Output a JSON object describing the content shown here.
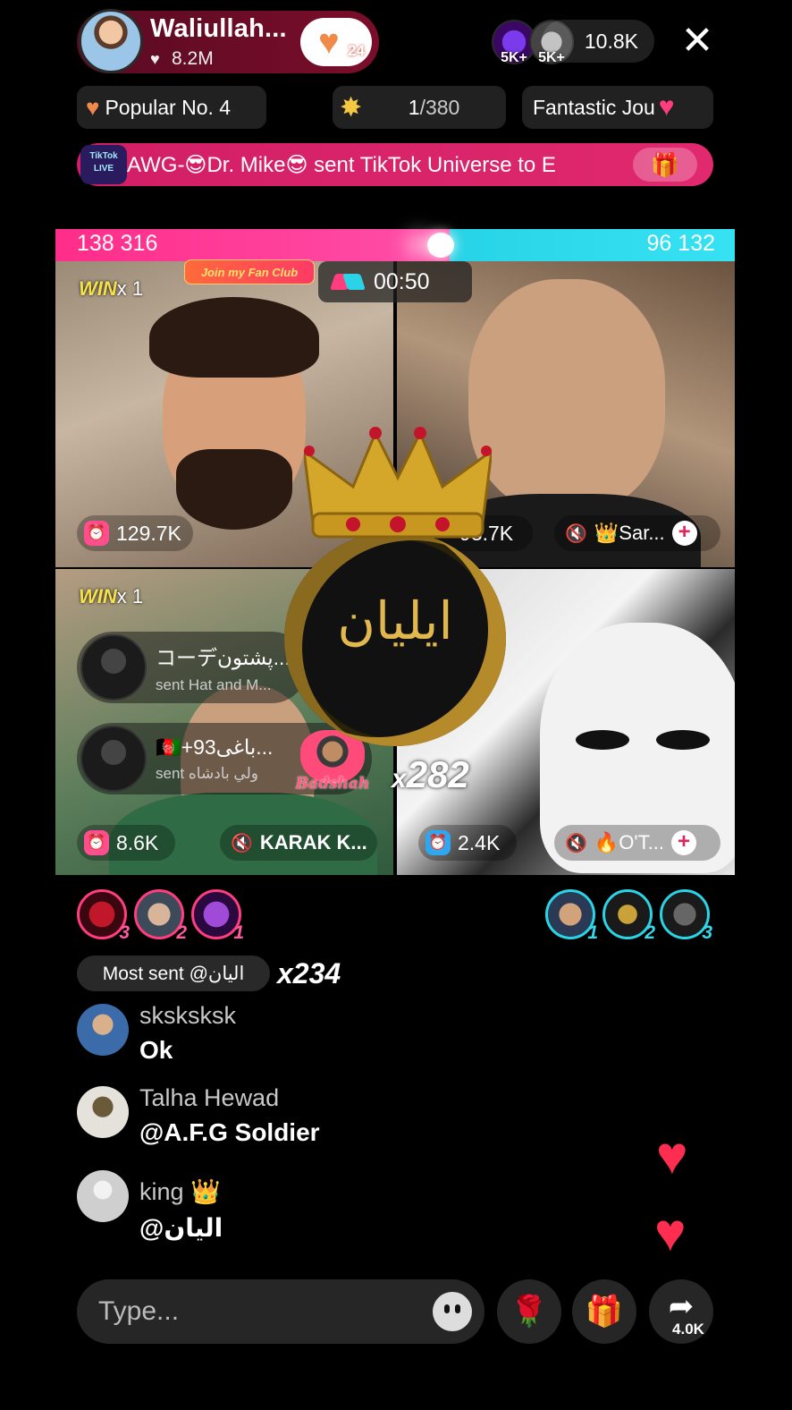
{
  "header": {
    "host_name": "Waliullah...",
    "host_likes": "8.2M",
    "fan_level": "24",
    "viewer_badges": [
      "5K+",
      "5K+"
    ],
    "viewer_count": "10.8K",
    "close_symbol": "✕"
  },
  "info_pills": {
    "popular": "Popular No. 4",
    "rank_current": "1",
    "rank_total": "/380",
    "fantastic": "Fantastic Jou"
  },
  "banner": {
    "text": "AWG-😎Dr. Mike😎 sent TikTok Universe to E"
  },
  "battle": {
    "score_left": "138 316",
    "score_right": "96 132",
    "timer": "00:50",
    "fan_club": "Join my Fan Club",
    "tiles": [
      {
        "win_label": "WIN",
        "win_mult": "x 1",
        "stat": "129.7K"
      },
      {
        "stat": "93.7K",
        "user": "👑Sar..."
      },
      {
        "win_label": "WIN",
        "win_mult": "x 1",
        "stat": "8.6K",
        "user": "KARAK K..."
      },
      {
        "stat": "2.4K",
        "user": "🔥O'T..."
      }
    ]
  },
  "gift_notifications": [
    {
      "name": "コーデپشتون...",
      "sub": "sent Hat and M..."
    },
    {
      "name": "🇦🇫+93باغی...",
      "sub": "sent ولي بادشاه"
    }
  ],
  "badshah_label": "Badshah",
  "medallion_text": "ایلیان",
  "center_gift_count": {
    "x": "x",
    "n": "282"
  },
  "gifters_left": [
    "3",
    "2",
    "1"
  ],
  "gifters_right": [
    "1",
    "2",
    "3"
  ],
  "most_sent": {
    "label": "Most sent @اليان",
    "count": "x234"
  },
  "comments": [
    {
      "name": "sksksksk",
      "text": "Ok"
    },
    {
      "name": "Talha Hewad",
      "text": "@A.F.G Soldier"
    },
    {
      "name": "king 👑",
      "text": "@اليان"
    }
  ],
  "bottom": {
    "placeholder": "Type...",
    "share_count": "4.0K"
  },
  "colors": {
    "pink": "#ff2d8a",
    "cyan": "#27d3e6",
    "banner": "#d21e66"
  }
}
